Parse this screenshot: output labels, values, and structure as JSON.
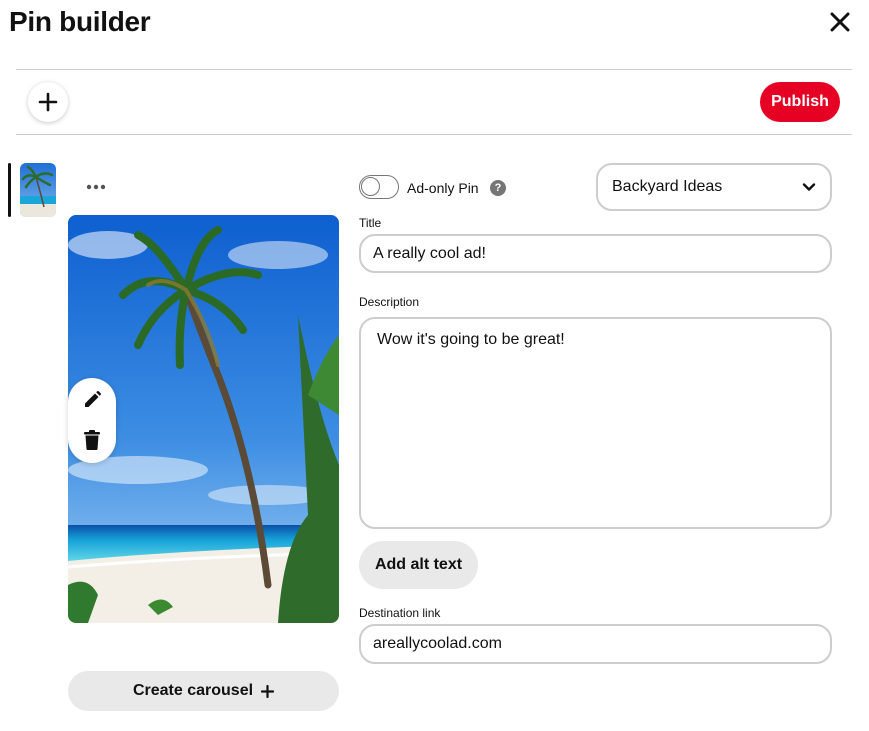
{
  "header": {
    "title": "Pin builder",
    "close_icon": "close-icon"
  },
  "toolbar": {
    "add_icon": "plus-icon",
    "publish_label": "Publish",
    "publish_color": "#e60023"
  },
  "left": {
    "more_icon": "ellipsis-icon",
    "edit_icon": "pencil-icon",
    "delete_icon": "trash-icon",
    "carousel_label": "Create carousel",
    "carousel_icon": "plus-icon"
  },
  "form": {
    "ad_only_label": "Ad-only Pin",
    "ad_only_enabled": false,
    "help_glyph": "?",
    "board": "Backyard Ideas",
    "title_label": "Title",
    "title_value": "A really cool ad!",
    "description_label": "Description",
    "description_value": "Wow it's going to be great!",
    "alt_text_label": "Add alt text",
    "link_label": "Destination link",
    "link_value": "areallycoolad.com"
  }
}
